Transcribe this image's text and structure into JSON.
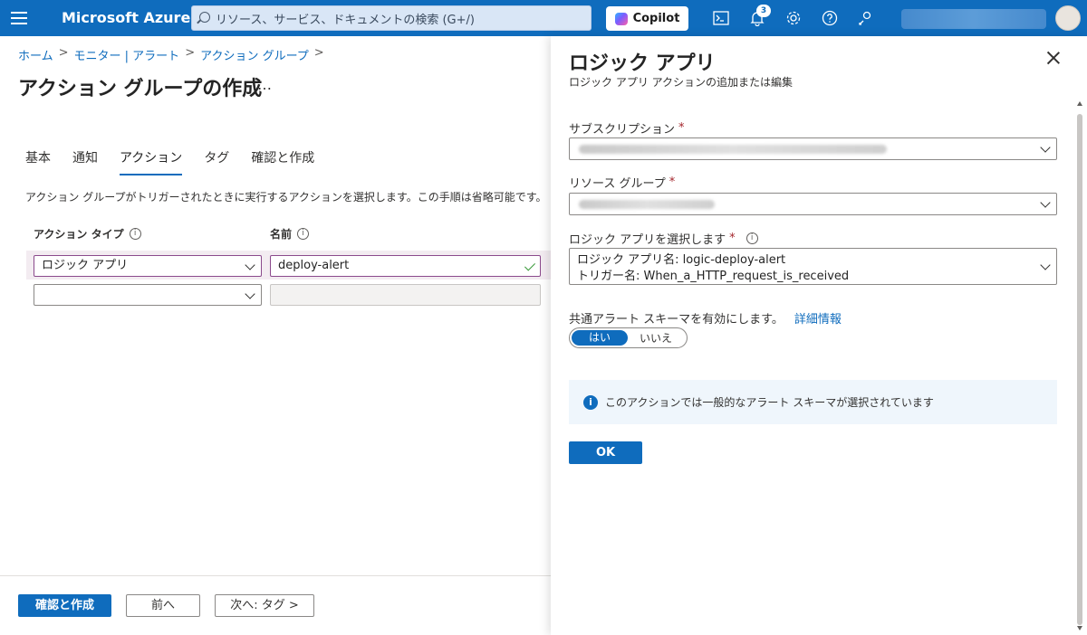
{
  "topbar": {
    "brand": "Microsoft Azure",
    "search_placeholder": "リソース、サービス、ドキュメントの検索 (G+/)",
    "copilot_label": "Copilot",
    "notification_count": "3",
    "icons": [
      "menu-icon",
      "cloud-shell-icon",
      "bell-icon",
      "gear-icon",
      "help-icon",
      "feedback-icon"
    ]
  },
  "breadcrumb": [
    "ホーム",
    "モニター | アラート",
    "アクション グループ"
  ],
  "page": {
    "title": "アクション グループの作成",
    "more": "…",
    "tabs": [
      "基本",
      "通知",
      "アクション",
      "タグ",
      "確認と作成"
    ],
    "active_tab": "アクション",
    "description": "アクション グループがトリガーされたときに実行するアクションを選択します。この手順は省略可能です。",
    "columns": {
      "action_type": "アクション タイプ",
      "name": "名前"
    },
    "rows": [
      {
        "action_type": "ロジック アプリ",
        "name": "deploy-alert"
      },
      {
        "action_type": "",
        "name": ""
      }
    ]
  },
  "footer": {
    "review_create": "確認と作成",
    "previous": "前へ",
    "next": "次へ: タグ >"
  },
  "panel": {
    "title": "ロジック アプリ",
    "subtitle": "ロジック アプリ アクションの追加または編集",
    "subscription_label": "サブスクリプション",
    "resource_group_label": "リソース グループ",
    "logic_app_label": "ロジック アプリを選択します",
    "logic_app_name_line": "ロジック アプリ名: logic-deploy-alert",
    "trigger_line": "トリガー名: When_a_HTTP_request_is_received",
    "common_schema_label": "共通アラート スキーマを有効にします。",
    "learn_more": "詳細情報",
    "toggle_yes": "はい",
    "toggle_no": "いいえ",
    "toggle_selected": "はい",
    "info_message": "このアクションでは一般的なアラート スキーマが選択されています",
    "ok_label": "OK"
  },
  "colors": {
    "accent": "#0f6cbd",
    "required": "#a4262c",
    "selected_row_band": "#f3ecf1",
    "valid_check": "#3a9a3a"
  }
}
